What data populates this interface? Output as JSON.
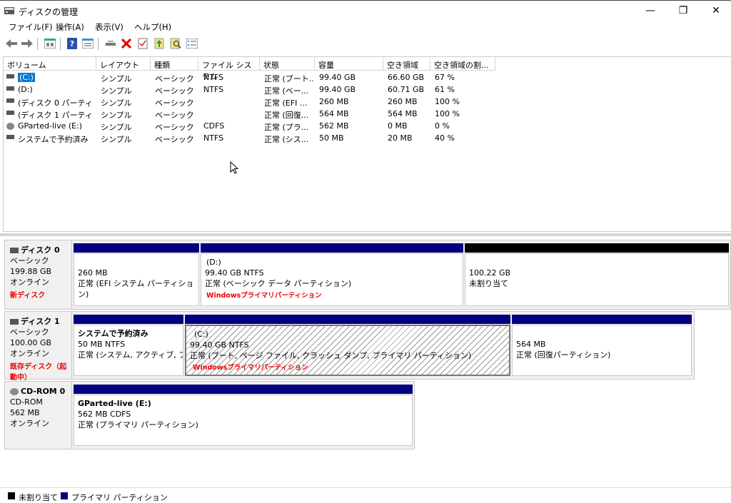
{
  "window": {
    "title": "ディスクの管理"
  },
  "menu": {
    "file": "ファイル(F)",
    "action": "操作(A)",
    "view": "表示(V)",
    "help": "ヘルプ(H)"
  },
  "toolbar": {
    "icons": [
      "back-arrow-icon",
      "forward-arrow-icon",
      "console-tree-icon",
      "help-icon",
      "properties-icon",
      "connect-icon",
      "delete-icon",
      "check-icon",
      "refresh-icon",
      "search-icon",
      "list-icon"
    ],
    "delete_color": "#e00000"
  },
  "volume_list": {
    "headers": [
      "ボリューム",
      "レイアウト",
      "種類",
      "ファイル システム",
      "状態",
      "容量",
      "空き領域",
      "空き領域の割..."
    ],
    "rows": [
      [
        "(C:)",
        "シンプル",
        "ベーシック",
        "NTFS",
        "正常 (ブート...",
        "99.40 GB",
        "66.60 GB",
        "67 %"
      ],
      [
        "(D:)",
        "シンプル",
        "ベーシック",
        "NTFS",
        "正常 (ベー...",
        "99.40 GB",
        "60.71 GB",
        "61 %"
      ],
      [
        "(ディスク 0 パーティシ...",
        "シンプル",
        "ベーシック",
        "",
        "正常 (EFI ...",
        "260 MB",
        "260 MB",
        "100 %"
      ],
      [
        "(ディスク 1 パーティシ...",
        "シンプル",
        "ベーシック",
        "",
        "正常 (回復...",
        "564 MB",
        "564 MB",
        "100 %"
      ],
      [
        "GParted-live (E:)",
        "シンプル",
        "ベーシック",
        "CDFS",
        "正常 (プラ...",
        "562 MB",
        "0 MB",
        "0 %"
      ],
      [
        "システムで予約済み",
        "シンプル",
        "ベーシック",
        "NTFS",
        "正常 (シス...",
        "50 MB",
        "20 MB",
        "40 %"
      ]
    ]
  },
  "disks": {
    "disk0": {
      "name": "ディスク 0",
      "type": "ベーシック",
      "size": "199.88 GB",
      "status": "オンライン",
      "note": "新ディスク",
      "parts": [
        {
          "title": "",
          "line1": "260 MB",
          "line2": "正常 (EFI システム パーティション)",
          "note": ""
        },
        {
          "title": "(D:)",
          "line1": "99.40 GB NTFS",
          "line2": "正常 (ベーシック データ パーティション)",
          "note": "Windowsプライマリパーティション"
        },
        {
          "title": "",
          "line1": "100.22 GB",
          "line2": "未割り当て",
          "note": ""
        }
      ]
    },
    "disk1": {
      "name": "ディスク 1",
      "type": "ベーシック",
      "size": "100.00 GB",
      "status": "オンライン",
      "note": "既存ディスク（起動中）",
      "parts": [
        {
          "title": "システムで予約済み",
          "line1": "50 MB NTFS",
          "line2": "正常 (システム, アクティブ, プラ",
          "note": ""
        },
        {
          "title": "(C:)",
          "line1": "99.40 GB NTFS",
          "line2": "正常 (ブート, ページ ファイル, クラッシュ ダンプ, プライマリ パーティション)",
          "note": "Windowsプライマリパーティション"
        },
        {
          "title": "",
          "line1": "564 MB",
          "line2": "正常 (回復パーティション)",
          "note": ""
        }
      ]
    },
    "cdrom0": {
      "name": "CD-ROM 0",
      "type": "CD-ROM",
      "size": "562 MB",
      "status": "オンライン",
      "parts": [
        {
          "title": "GParted-live  (E:)",
          "line1": "562 MB CDFS",
          "line2": "正常 (プライマリ パーティション)"
        }
      ]
    }
  },
  "legend": {
    "unallocated": "未割り当て",
    "primary": "プライマリ パーティション"
  },
  "colors": {
    "primary_bar": "#000080",
    "unallocated_bar": "#000000",
    "selection": "#0078d7",
    "note_red": "#e00000"
  }
}
